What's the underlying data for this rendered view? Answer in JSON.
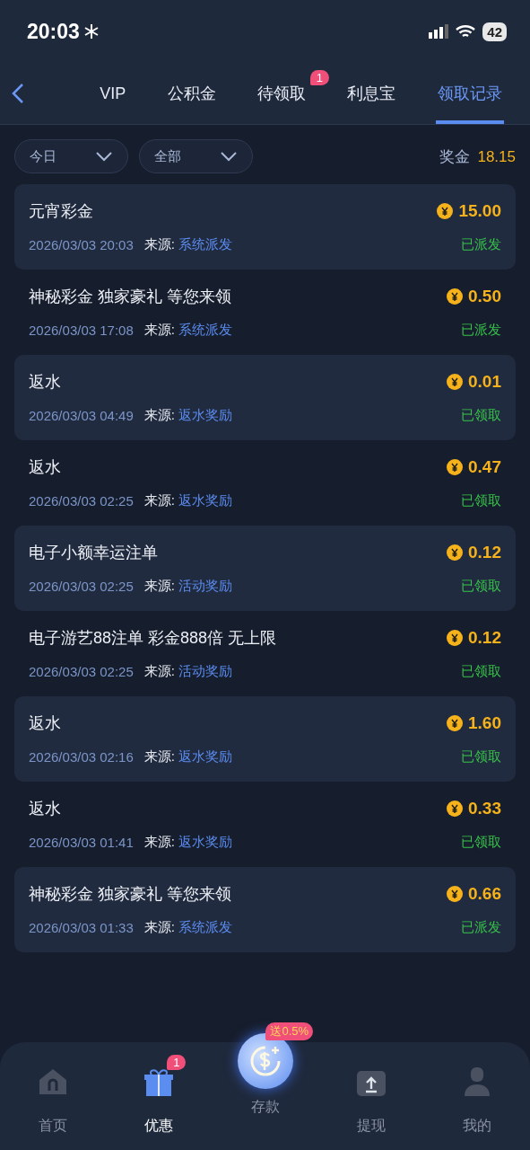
{
  "status_bar": {
    "time": "20:03",
    "battery": "42"
  },
  "tabs": [
    {
      "label": "VIP",
      "selected": false
    },
    {
      "label": "公积金",
      "selected": false
    },
    {
      "label": "待领取",
      "selected": false,
      "badge": "1"
    },
    {
      "label": "利息宝",
      "selected": false
    },
    {
      "label": "领取记录",
      "selected": true
    }
  ],
  "filters": [
    {
      "value": "今日"
    },
    {
      "value": "全部"
    }
  ],
  "bonus": {
    "label": "奖金",
    "value": "18.15"
  },
  "records": [
    {
      "title": "元宵彩金",
      "amount": "15.00",
      "time": "2026/03/03 20:03",
      "source_label": "来源:",
      "source": "系统派发",
      "status": "已派发"
    },
    {
      "title": "神秘彩金 独家豪礼 等您来领",
      "amount": "0.50",
      "time": "2026/03/03 17:08",
      "source_label": "来源:",
      "source": "系统派发",
      "status": "已派发"
    },
    {
      "title": "返水",
      "amount": "0.01",
      "time": "2026/03/03 04:49",
      "source_label": "来源:",
      "source": "返水奖励",
      "status": "已领取"
    },
    {
      "title": "返水",
      "amount": "0.47",
      "time": "2026/03/03 02:25",
      "source_label": "来源:",
      "source": "返水奖励",
      "status": "已领取"
    },
    {
      "title": "电子小额幸运注单",
      "amount": "0.12",
      "time": "2026/03/03 02:25",
      "source_label": "来源:",
      "source": "活动奖励",
      "status": "已领取"
    },
    {
      "title": "电子游艺88注单 彩金888倍 无上限",
      "amount": "0.12",
      "time": "2026/03/03 02:25",
      "source_label": "来源:",
      "source": "活动奖励",
      "status": "已领取"
    },
    {
      "title": "返水",
      "amount": "1.60",
      "time": "2026/03/03 02:16",
      "source_label": "来源:",
      "source": "返水奖励",
      "status": "已领取"
    },
    {
      "title": "返水",
      "amount": "0.33",
      "time": "2026/03/03 01:41",
      "source_label": "来源:",
      "source": "返水奖励",
      "status": "已领取"
    },
    {
      "title": "神秘彩金 独家豪礼 等您来领",
      "amount": "0.66",
      "time": "2026/03/03 01:33",
      "source_label": "来源:",
      "source": "系统派发",
      "status": "已派发"
    }
  ],
  "bottom_nav": [
    {
      "kind": "home",
      "label": "首页",
      "selected": false
    },
    {
      "kind": "gift",
      "label": "优惠",
      "selected": true,
      "badge": "1"
    },
    {
      "kind": "deposit",
      "label": "存款",
      "selected": false,
      "badge": "送0.5%"
    },
    {
      "kind": "withdraw",
      "label": "提现",
      "selected": false
    },
    {
      "kind": "profile",
      "label": "我的",
      "selected": false
    }
  ]
}
